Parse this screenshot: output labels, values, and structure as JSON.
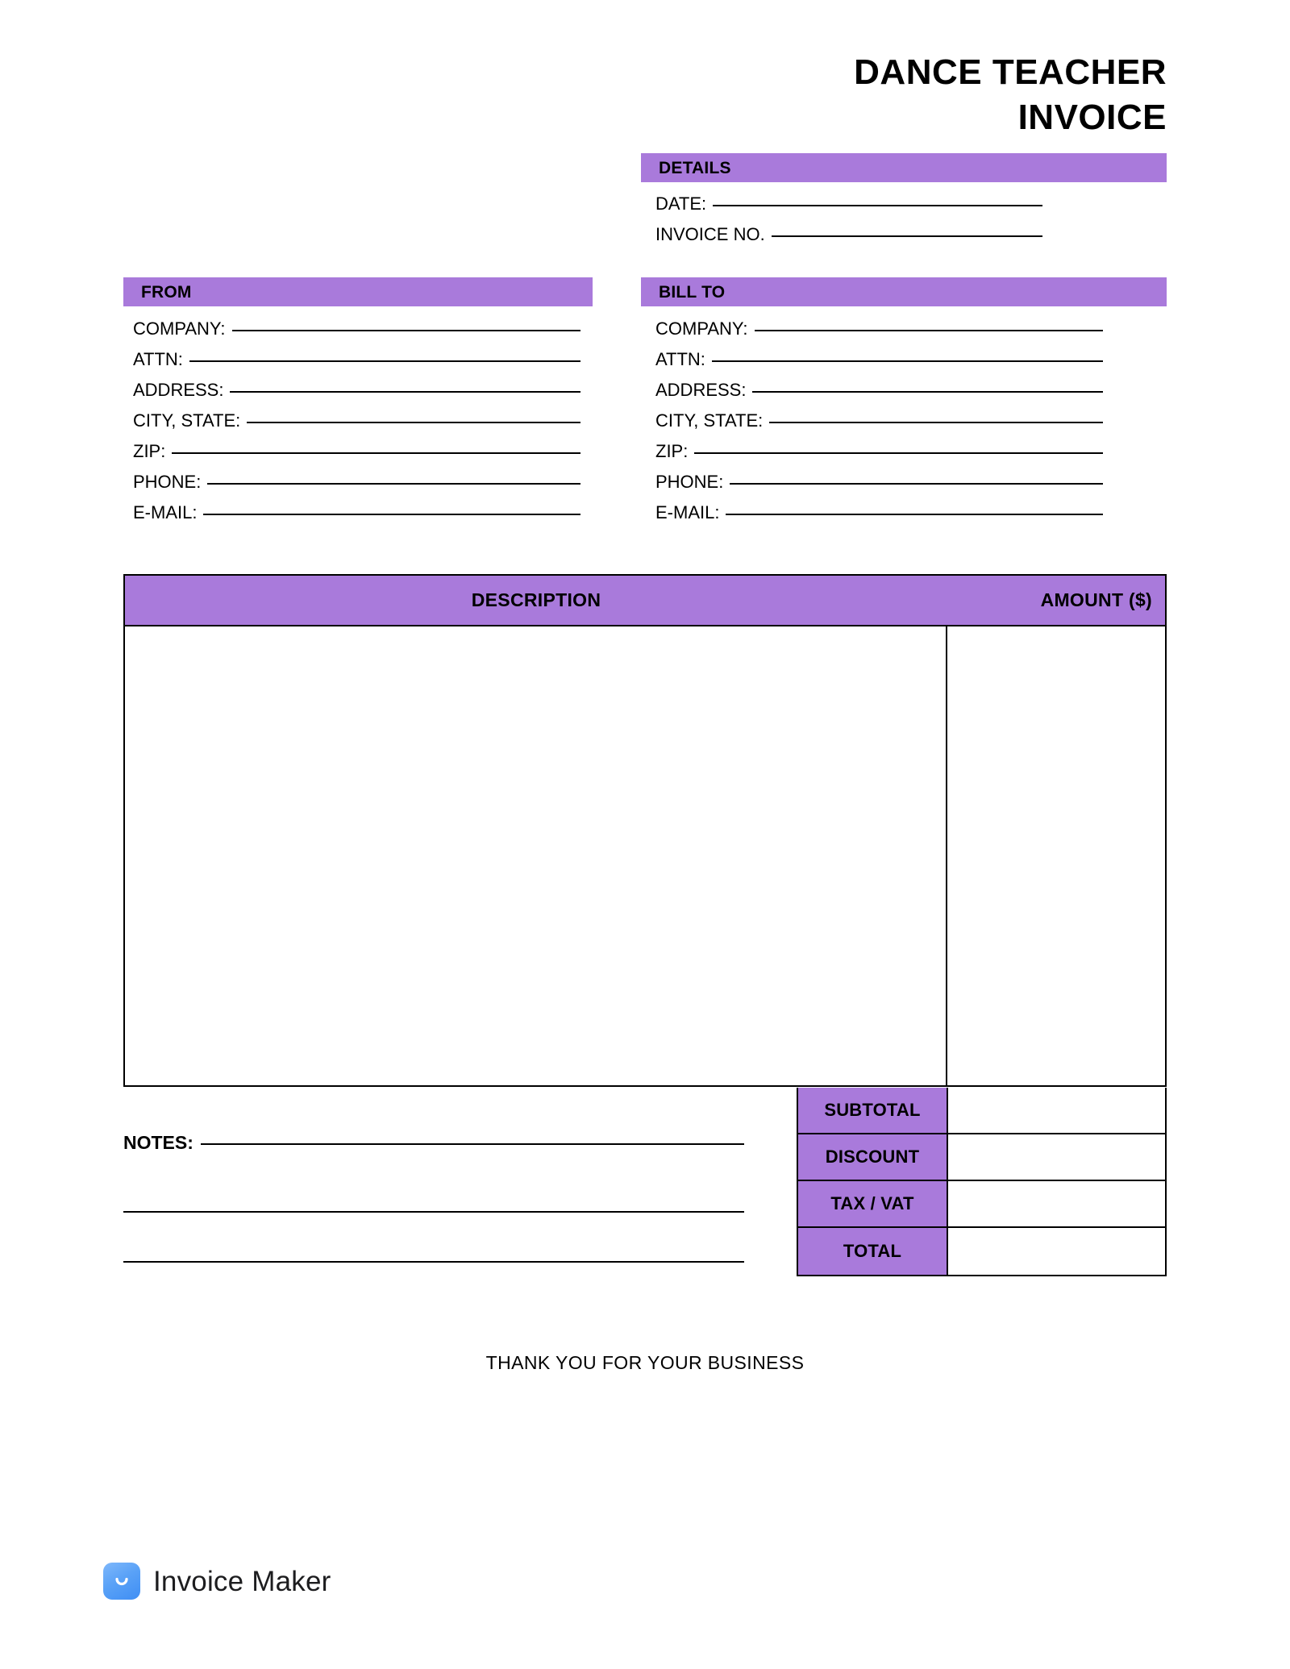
{
  "document": {
    "title_line_1": "DANCE TEACHER",
    "title_line_2": "INVOICE"
  },
  "details": {
    "heading": "DETAILS",
    "fields": [
      {
        "label": "DATE:"
      },
      {
        "label": "INVOICE NO."
      }
    ]
  },
  "from": {
    "heading": "FROM",
    "fields": [
      {
        "label": "COMPANY:"
      },
      {
        "label": "ATTN:"
      },
      {
        "label": "ADDRESS:"
      },
      {
        "label": "CITY, STATE:"
      },
      {
        "label": "ZIP:"
      },
      {
        "label": "PHONE:"
      },
      {
        "label": "E-MAIL:"
      }
    ]
  },
  "bill_to": {
    "heading": "BILL TO",
    "fields": [
      {
        "label": "COMPANY:"
      },
      {
        "label": "ATTN:"
      },
      {
        "label": "ADDRESS:"
      },
      {
        "label": "CITY, STATE:"
      },
      {
        "label": "ZIP:"
      },
      {
        "label": "PHONE:"
      },
      {
        "label": "E-MAIL:"
      }
    ]
  },
  "items_table": {
    "columns": [
      {
        "label": "DESCRIPTION"
      },
      {
        "label": "AMOUNT ($)"
      }
    ],
    "rows": []
  },
  "notes": {
    "label": "NOTES:",
    "lines": [
      "",
      "",
      ""
    ]
  },
  "totals": {
    "rows": [
      {
        "label": "SUBTOTAL",
        "value": ""
      },
      {
        "label": "DISCOUNT",
        "value": ""
      },
      {
        "label": "TAX / VAT",
        "value": ""
      },
      {
        "label": "TOTAL",
        "value": ""
      }
    ]
  },
  "footer": {
    "thank_you": "THANK YOU FOR YOUR BUSINESS",
    "brand_name": "Invoice Maker",
    "brand_icon": "invoice-maker-logo-icon"
  },
  "theme": {
    "accent_purple": "#a97adb",
    "rule_color": "#000000",
    "logo_blue": "#4f9af6"
  }
}
